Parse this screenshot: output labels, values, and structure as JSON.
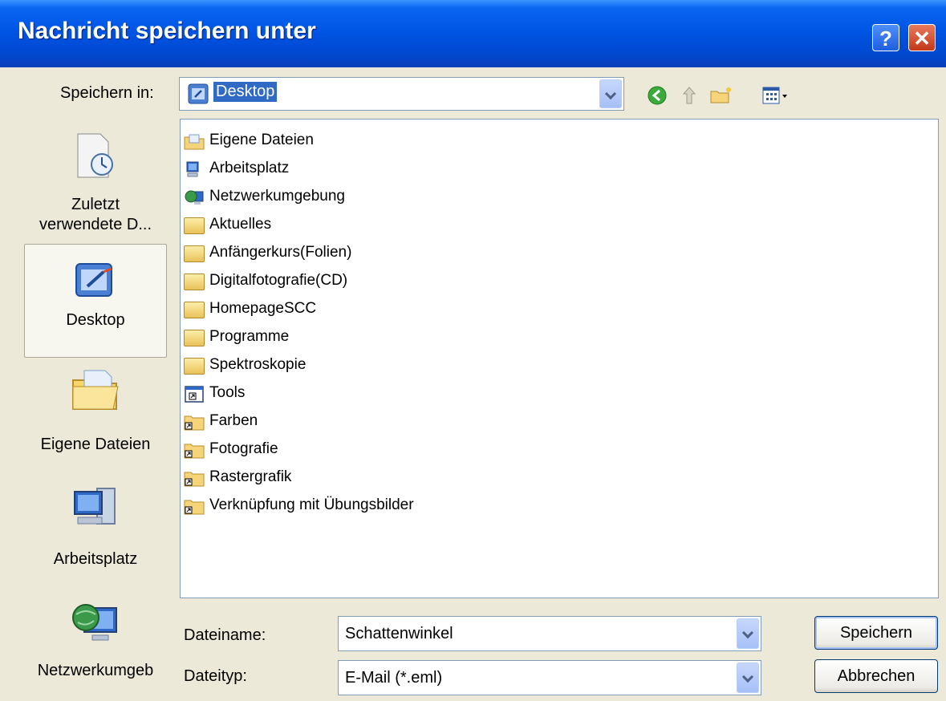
{
  "window": {
    "title": "Nachricht speichern unter",
    "help_glyph": "?",
    "close_glyph": "✕"
  },
  "toolbar": {
    "save_in_label": "Speichern in:",
    "location": "Desktop",
    "icons": [
      "back-icon",
      "up-folder-icon",
      "new-folder-icon",
      "views-icon"
    ]
  },
  "places": [
    {
      "label": "Zuletzt verwendete D...",
      "icon": "recent-docs-icon",
      "selected": false
    },
    {
      "label": "Desktop",
      "icon": "desktop-icon",
      "selected": true
    },
    {
      "label": "Eigene Dateien",
      "icon": "my-documents-icon",
      "selected": false
    },
    {
      "label": "Arbeitsplatz",
      "icon": "my-computer-icon",
      "selected": false
    },
    {
      "label": "Netzwerkumgeb",
      "icon": "network-icon",
      "selected": false
    }
  ],
  "files": [
    {
      "name": "Eigene Dateien",
      "icon": "my-documents-icon"
    },
    {
      "name": "Arbeitsplatz",
      "icon": "my-computer-icon"
    },
    {
      "name": "Netzwerkumgebung",
      "icon": "network-icon"
    },
    {
      "name": "Aktuelles",
      "icon": "folder-icon"
    },
    {
      "name": "Anfängerkurs(Folien)",
      "icon": "folder-icon"
    },
    {
      "name": "Digitalfotografie(CD)",
      "icon": "folder-icon"
    },
    {
      "name": "HomepageSCC",
      "icon": "folder-icon"
    },
    {
      "name": "Programme",
      "icon": "folder-icon"
    },
    {
      "name": "Spektroskopie",
      "icon": "folder-icon"
    },
    {
      "name": "Tools",
      "icon": "window-shortcut-icon"
    },
    {
      "name": "Farben",
      "icon": "folder-shortcut-icon"
    },
    {
      "name": "Fotografie",
      "icon": "folder-shortcut-icon"
    },
    {
      "name": "Rastergrafik",
      "icon": "folder-shortcut-icon"
    },
    {
      "name": "Verknüpfung mit Übungsbilder",
      "icon": "folder-shortcut-icon"
    }
  ],
  "form": {
    "filename_label": "Dateiname:",
    "filename_value": "Schattenwinkel",
    "filetype_label": "Dateityp:",
    "filetype_value": "E-Mail (*.eml)"
  },
  "buttons": {
    "save": "Speichern",
    "cancel": "Abbrechen"
  },
  "colors": {
    "titlebar": "#0055E5",
    "selection": "#316AC5",
    "dialog_bg": "#ECE9D8"
  }
}
